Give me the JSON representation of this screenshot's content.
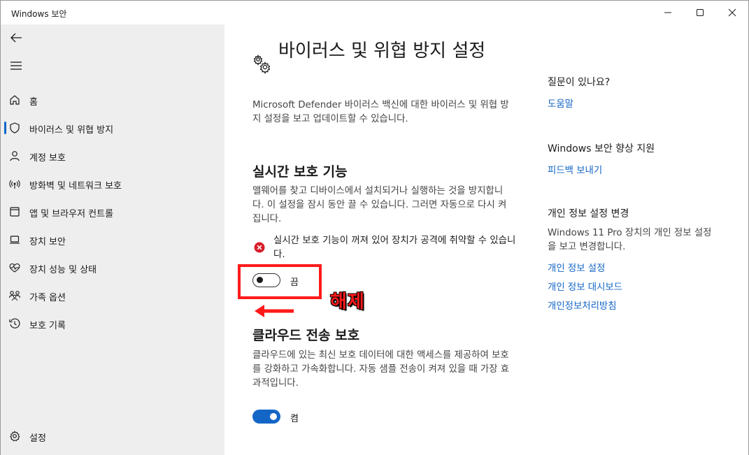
{
  "window": {
    "title": "Windows 보안"
  },
  "sidebar": {
    "items": [
      {
        "label": "홈",
        "icon": "home-icon"
      },
      {
        "label": "바이러스 및 위협 방지",
        "icon": "shield-icon",
        "active": true
      },
      {
        "label": "계정 보호",
        "icon": "person-icon"
      },
      {
        "label": "방화벽 및 네트워크 보호",
        "icon": "wireless-icon"
      },
      {
        "label": "앱 및 브라우저 컨트롤",
        "icon": "app-window-icon"
      },
      {
        "label": "장치 보안",
        "icon": "laptop-icon"
      },
      {
        "label": "장치 성능 및 상태",
        "icon": "heart-pulse-icon"
      },
      {
        "label": "가족 옵션",
        "icon": "family-icon"
      },
      {
        "label": "보호 기록",
        "icon": "history-icon"
      }
    ],
    "settings_label": "설정"
  },
  "main": {
    "title": "바이러스 및 위협 방지 설정",
    "description": "Microsoft Defender 바이러스 백신에 대한 바이러스 및 위협 방지 설정을 보고 업데이트할 수 있습니다.",
    "realtime": {
      "title": "실시간 보호 기능",
      "description": "맬웨어를 찾고 디바이스에서 설치되거나 실행하는 것을 방지합니다. 이 설정을 잠시 동안 끌 수 있습니다. 그러면 자동으로 다시 켜집니다.",
      "warning": "실시간 보호 기능이 꺼져 있어 장치가 공격에 취약할 수 있습니다.",
      "toggle_label": "끔",
      "toggle_on": false
    },
    "cloud": {
      "title": "클라우드 전송 보호",
      "description": "클라우드에 있는 최신 보호 데이터에 대한 액세스를 제공하여 보호를 강화하고 가속화합니다. 자동 샘플 전송이 켜져 있을 때 가장 효과적입니다.",
      "toggle_label": "켬",
      "toggle_on": true
    }
  },
  "annotation": {
    "text": "해제",
    "color": "#ff1a1a"
  },
  "right": {
    "question_heading": "질문이 있나요?",
    "help_link": "도움말",
    "improve_heading": "Windows 보안 향상 지원",
    "feedback_link": "피드백 보내기",
    "privacy_heading": "개인 정보 설정 변경",
    "privacy_desc": "Windows 11 Pro 장치의 개인 정보 설정을 보고 변경합니다.",
    "links": [
      "개인 정보 설정",
      "개인 정보 대시보드",
      "개인정보처리방침"
    ]
  },
  "colors": {
    "accent": "#1366c6",
    "sidebar_bg": "#eeeeee",
    "error": "#d81e2a"
  }
}
